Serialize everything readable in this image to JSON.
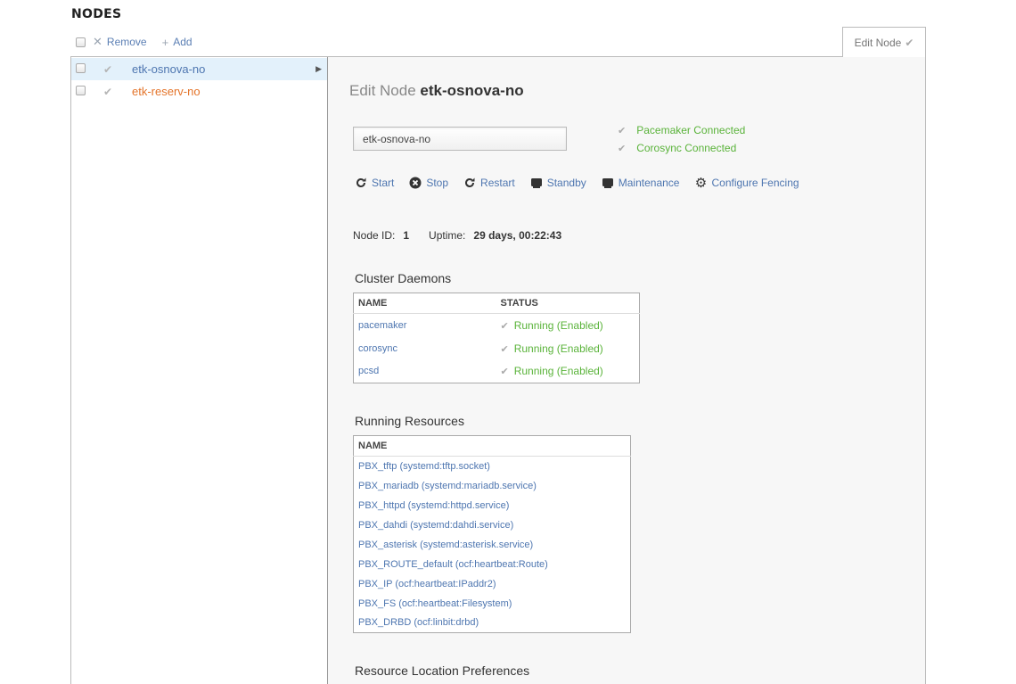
{
  "page": {
    "title": "NODES"
  },
  "toolbar": {
    "remove_label": "Remove",
    "add_label": "Add"
  },
  "edit_tab": {
    "label": "Edit Node"
  },
  "nodes": [
    {
      "name": "etk-osnova-no",
      "selected": true,
      "color": "#4e76b0"
    },
    {
      "name": "etk-reserv-no",
      "selected": false,
      "color": "#e4742a"
    }
  ],
  "edit": {
    "title_prefix": "Edit Node",
    "node_name": "etk-osnova-no",
    "input_value": "etk-osnova-no",
    "pacemaker_status": "Pacemaker Connected",
    "corosync_status": "Corosync Connected"
  },
  "actions": {
    "start": "Start",
    "stop": "Stop",
    "restart": "Restart",
    "standby": "Standby",
    "maintenance": "Maintenance",
    "fencing": "Configure Fencing"
  },
  "info": {
    "node_id_label": "Node ID:",
    "node_id": "1",
    "uptime_label": "Uptime:",
    "uptime": "29 days, 00:22:43"
  },
  "daemons": {
    "title": "Cluster Daemons",
    "headers": [
      "NAME",
      "STATUS"
    ],
    "rows": [
      {
        "name": "pacemaker",
        "status": "Running (Enabled)"
      },
      {
        "name": "corosync",
        "status": "Running (Enabled)"
      },
      {
        "name": "pcsd",
        "status": "Running (Enabled)"
      }
    ]
  },
  "resources": {
    "title": "Running Resources",
    "header": "NAME",
    "rows": [
      "PBX_tftp (systemd:tftp.socket)",
      "PBX_mariadb (systemd:mariadb.service)",
      "PBX_httpd (systemd:httpd.service)",
      "PBX_dahdi (systemd:dahdi.service)",
      "PBX_asterisk (systemd:asterisk.service)",
      "PBX_ROUTE_default (ocf:heartbeat:Route)",
      "PBX_IP (ocf:heartbeat:IPaddr2)",
      "PBX_FS (ocf:heartbeat:Filesystem)",
      "PBX_DRBD (ocf:linbit:drbd)"
    ]
  },
  "location": {
    "title": "Resource Location Preferences"
  },
  "colors": {
    "link": "#4e76b0",
    "success": "#5ab33a",
    "warning": "#e4742a",
    "selected_bg": "#e3f1fb"
  }
}
